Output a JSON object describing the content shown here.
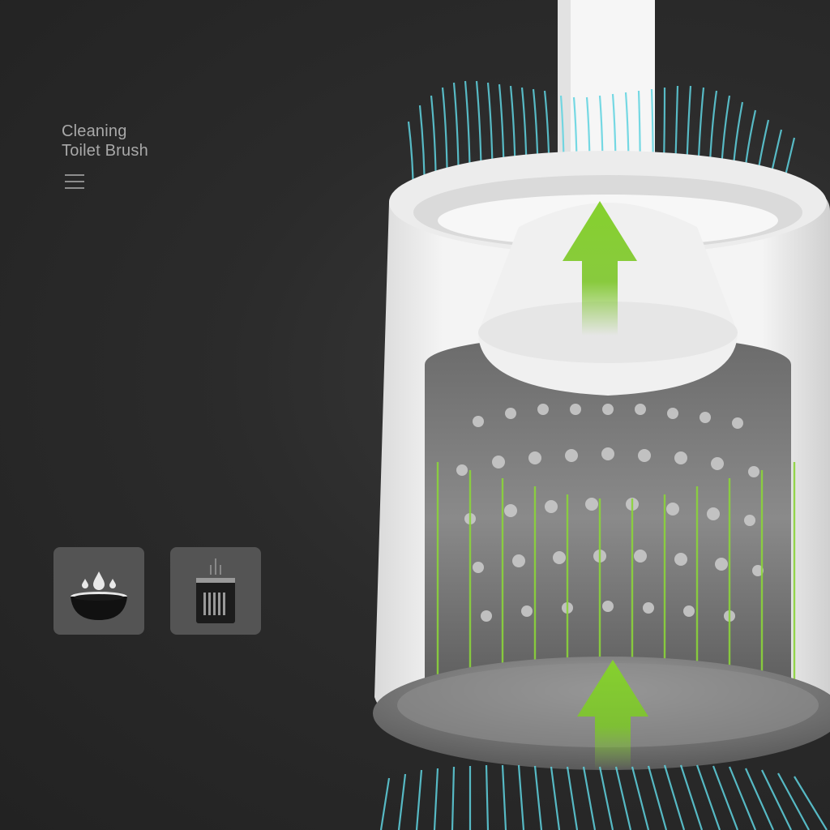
{
  "product": {
    "title_line_1": "Cleaning",
    "title_line_2": "Toilet Brush"
  },
  "icons": {
    "menu": "menu-lines-icon",
    "water_drop": "water-drops-bowl-icon",
    "drain": "drain-basket-icon",
    "arrow": "arrow-up-icon"
  },
  "colors": {
    "background": "#2a2a2a",
    "title_text": "#a8a8a8",
    "tile_bg": "#545454",
    "arrow_green": "#7dc62a",
    "airflow_cyan": "#5fd3e0",
    "holder_white": "#f2f2f2"
  }
}
